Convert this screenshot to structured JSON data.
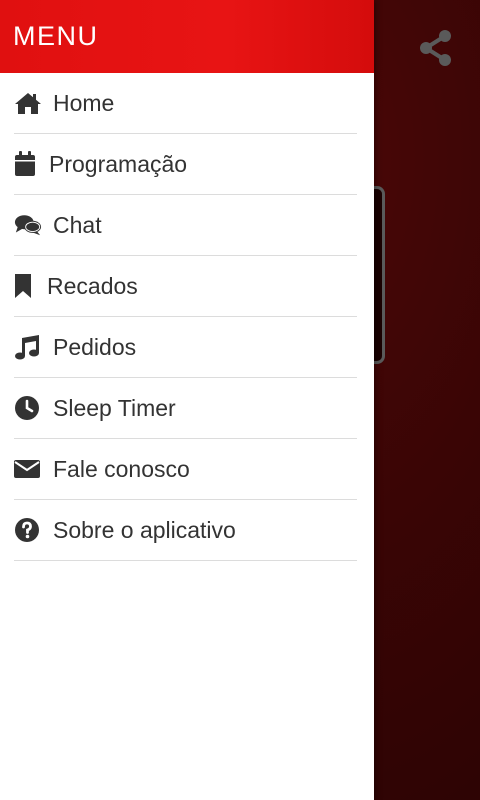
{
  "drawer": {
    "title": "MENU",
    "items": [
      {
        "label": "Home",
        "icon": "home-icon"
      },
      {
        "label": "Programação",
        "icon": "calendar-icon"
      },
      {
        "label": "Chat",
        "icon": "chat-icon"
      },
      {
        "label": "Recados",
        "icon": "bookmark-icon"
      },
      {
        "label": "Pedidos",
        "icon": "music-note-icon"
      },
      {
        "label": "Sleep Timer",
        "icon": "clock-icon"
      },
      {
        "label": "Fale conosco",
        "icon": "envelope-icon"
      },
      {
        "label": "Sobre o aplicativo",
        "icon": "question-icon"
      }
    ]
  },
  "share": {
    "icon": "share-icon"
  },
  "colors": {
    "header": "#e81414",
    "icon": "#333333",
    "background": "#2a0404"
  }
}
